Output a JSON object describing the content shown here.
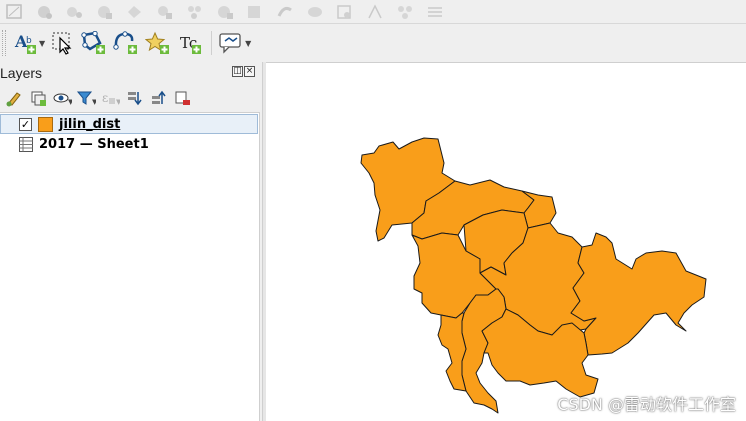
{
  "toolbar_top": {
    "icons": [
      "digitize-icon",
      "save-edits-icon",
      "add-feature-icon",
      "move-feature-icon",
      "vertex-tool-icon",
      "delete-feature-icon",
      "cut-feature-icon",
      "copy-feature-icon",
      "paste-feature-icon",
      "undo-icon",
      "redo-icon",
      "label-toggle-icon",
      "rotate-label-icon",
      "node-tool-icon",
      "options-icon"
    ]
  },
  "toolbar_main": {
    "tools": [
      {
        "name": "label-tool-icon",
        "has_dropdown": true
      },
      {
        "name": "select-features-icon",
        "has_dropdown": false
      },
      {
        "name": "add-polygon-icon",
        "has_dropdown": false
      },
      {
        "name": "add-curve-icon",
        "has_dropdown": false
      },
      {
        "name": "add-point-icon",
        "has_dropdown": false
      },
      {
        "name": "add-text-annotation-icon",
        "has_dropdown": false
      },
      {
        "name": "map-tips-icon",
        "has_dropdown": true
      }
    ],
    "label_text": "Tc"
  },
  "layers_panel": {
    "title": "Layers",
    "float_button": "◫",
    "close_button": "×",
    "tools": [
      "open-styling-icon",
      "add-group-icon",
      "manage-visibility-icon",
      "filter-legend-icon",
      "filter-expression-icon",
      "expand-all-icon",
      "collapse-all-icon",
      "remove-layer-icon"
    ],
    "layers": [
      {
        "name": "jilin_dist",
        "checked": true,
        "checkmark": "✓",
        "swatch_color": "#f99e1a",
        "type": "vector",
        "selected": true
      },
      {
        "name": "2017 — Sheet1",
        "type": "table",
        "selected": false
      }
    ]
  },
  "map": {
    "background": "#ffffff",
    "fill_color": "#f99e1a",
    "stroke_color": "#1a1a1a"
  },
  "watermark": "CSDN @雷动软件工作室"
}
